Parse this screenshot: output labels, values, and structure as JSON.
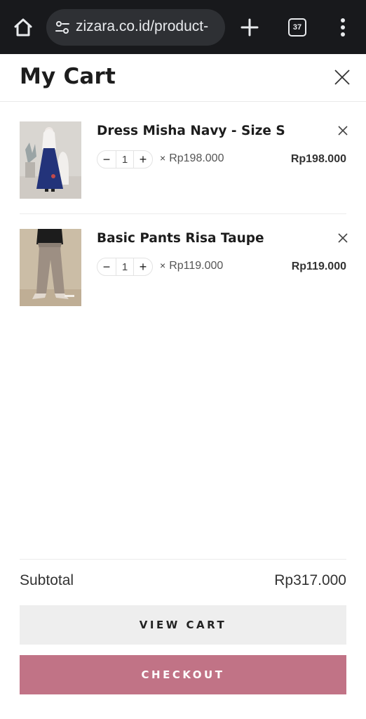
{
  "browser": {
    "url": "zizara.co.id/product-",
    "tab_count": "37",
    "icons": [
      "home-icon",
      "site-settings-icon",
      "plus-icon",
      "tab-switcher-icon",
      "more-vert-icon"
    ]
  },
  "cart": {
    "title": "My Cart",
    "items": [
      {
        "name": "Dress Misha Navy - Size S",
        "quantity": "1",
        "minus": "−",
        "plus": "+",
        "times": "×",
        "unit_price": "Rp198.000",
        "line_total": "Rp198.000"
      },
      {
        "name": "Basic Pants Risa Taupe",
        "quantity": "1",
        "minus": "−",
        "plus": "+",
        "times": "×",
        "unit_price": "Rp119.000",
        "line_total": "Rp119.000"
      }
    ],
    "subtotal_label": "Subtotal",
    "subtotal_value": "Rp317.000",
    "view_cart_label": "VIEW CART",
    "checkout_label": "CHECKOUT"
  },
  "colors": {
    "chrome_bg": "#18191c",
    "checkout_bg": "#c17386",
    "view_cart_bg": "#eeeeee"
  }
}
